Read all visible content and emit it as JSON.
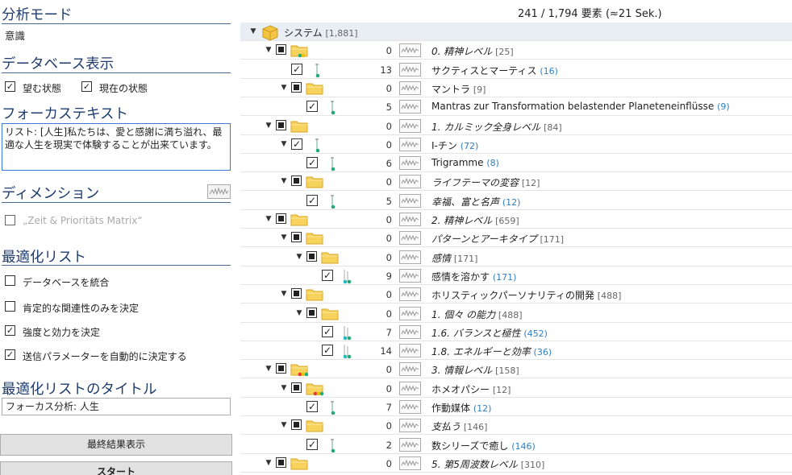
{
  "left": {
    "analysis_mode": {
      "title": "分析モード",
      "value": "意識"
    },
    "database_display": {
      "title": "データベース表示",
      "options": [
        {
          "label": "望む状態",
          "checked": true
        },
        {
          "label": "現在の状態",
          "checked": true
        }
      ]
    },
    "focus_text": {
      "title": "フォーカステキスト",
      "value": "リスト: [人生]私たちは、愛と感謝に満ち溢れ、最適な人生を現実で体験することが出来ています。"
    },
    "dimension": {
      "title": "ディメンション",
      "icon": "sparkline-icon",
      "option": {
        "label": "„Zeit & Prioritäts Matrix“",
        "checked": false,
        "disabled": true
      }
    },
    "optimization_list": {
      "title": "最適化リスト",
      "options": [
        {
          "label": "データベースを統合",
          "checked": false
        },
        {
          "label": "肯定的な関連性のみを決定",
          "checked": false
        },
        {
          "label": "強度と効力を決定",
          "checked": true
        },
        {
          "label": "送信パラメーターを自動的に決定する",
          "checked": true
        }
      ]
    },
    "list_title": {
      "title": "最適化リストのタイトル",
      "value": "フォーカス分析: 人生"
    },
    "buttons": {
      "final_results": "最終結果表示",
      "start": "スタート"
    }
  },
  "right": {
    "count": "241 / 1,794 要素 (≈21 Sek.)",
    "rows": [
      {
        "level": 0,
        "type": "root",
        "num": "",
        "name": "システム",
        "count": "[1,881]",
        "italic": false,
        "blue": false
      },
      {
        "level": 1,
        "type": "folder",
        "num": "0",
        "name": "0. 精神レベル",
        "count": "[25]",
        "italic": true,
        "blue": false,
        "dots": [
          "#2a7",
          "#e6c200"
        ]
      },
      {
        "level": 2,
        "type": "leaf",
        "num": "13",
        "name": "サクティスとマーティス",
        "count": "(16)",
        "italic": false,
        "blue": true
      },
      {
        "level": 2,
        "type": "folder",
        "num": "0",
        "name": "マントラ",
        "count": "[9]",
        "italic": false,
        "blue": false,
        "dots": []
      },
      {
        "level": 3,
        "type": "leaf",
        "num": "5",
        "name": "Mantras zur Transformation belastender Planeteneinflüsse",
        "count": "(9)",
        "italic": false,
        "blue": true
      },
      {
        "level": 1,
        "type": "folder",
        "num": "0",
        "name": "1. カルミック全身レベル",
        "count": "[84]",
        "italic": true,
        "blue": false,
        "dots": []
      },
      {
        "level": 2,
        "type": "leafcb",
        "num": "0",
        "name": "I-チン",
        "count": "(72)",
        "italic": false,
        "blue": true
      },
      {
        "level": 3,
        "type": "leaf",
        "num": "6",
        "name": "Trigramme",
        "count": "(8)",
        "italic": false,
        "blue": true
      },
      {
        "level": 2,
        "type": "folder",
        "num": "0",
        "name": "ライフテーマの変容",
        "count": "[12]",
        "italic": true,
        "blue": false,
        "dots": []
      },
      {
        "level": 3,
        "type": "leaf",
        "num": "5",
        "name": "幸福、富と名声",
        "count": "(12)",
        "italic": true,
        "blue": true
      },
      {
        "level": 1,
        "type": "folder",
        "num": "0",
        "name": "2. 精神レベル",
        "count": "[659]",
        "italic": true,
        "blue": false,
        "dots": []
      },
      {
        "level": 2,
        "type": "folder",
        "num": "0",
        "name": "パターンとアーキタイプ",
        "count": "[171]",
        "italic": true,
        "blue": false,
        "dots": []
      },
      {
        "level": 3,
        "type": "folder",
        "num": "0",
        "name": "感情",
        "count": "[171]",
        "italic": true,
        "blue": false,
        "dots": []
      },
      {
        "level": 4,
        "type": "leaf",
        "num": "9",
        "name": "感情を溶かす",
        "count": "(171)",
        "italic": false,
        "blue": true
      },
      {
        "level": 2,
        "type": "folder",
        "num": "0",
        "name": "ホリスティックパーソナリティの開発",
        "count": "[488]",
        "italic": false,
        "blue": false,
        "dots": []
      },
      {
        "level": 3,
        "type": "folder",
        "num": "0",
        "name": "1. 個々 の能力",
        "count": "[488]",
        "italic": true,
        "blue": false,
        "dots": []
      },
      {
        "level": 4,
        "type": "leaf",
        "num": "7",
        "name": "1.6. バランスと極性",
        "count": "(452)",
        "italic": true,
        "blue": true
      },
      {
        "level": 4,
        "type": "leaf",
        "num": "14",
        "name": "1.8. エネルギーと効率",
        "count": "(36)",
        "italic": true,
        "blue": true
      },
      {
        "level": 1,
        "type": "folder",
        "num": "0",
        "name": "3. 情報レベル",
        "count": "[158]",
        "italic": true,
        "blue": false,
        "dots": [
          "#e03a2f",
          "#e6c200",
          "#2a7"
        ]
      },
      {
        "level": 2,
        "type": "folder",
        "num": "0",
        "name": "ホメオパシー",
        "count": "[12]",
        "italic": false,
        "blue": false,
        "dots": [
          "#e03a2f",
          "#e6c200",
          "#2a7"
        ]
      },
      {
        "level": 3,
        "type": "leaf",
        "num": "7",
        "name": "作動媒体",
        "count": "(12)",
        "italic": false,
        "blue": true
      },
      {
        "level": 2,
        "type": "folder",
        "num": "0",
        "name": "支払う",
        "count": "[146]",
        "italic": true,
        "blue": false,
        "dots": []
      },
      {
        "level": 3,
        "type": "leaf",
        "num": "2",
        "name": "数シリーズで癒し",
        "count": "(146)",
        "italic": false,
        "blue": true
      },
      {
        "level": 1,
        "type": "folder",
        "num": "0",
        "name": "5. 第5周波数レベル",
        "count": "[310]",
        "italic": true,
        "blue": false,
        "dots": []
      }
    ]
  }
}
